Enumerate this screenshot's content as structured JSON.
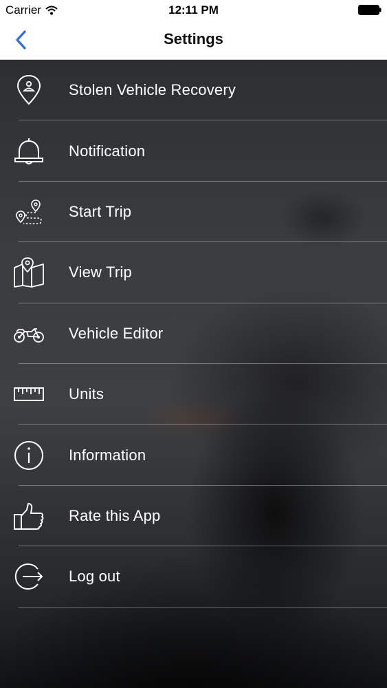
{
  "status_bar": {
    "carrier": "Carrier",
    "time": "12:11 PM"
  },
  "nav": {
    "title": "Settings",
    "accent_color": "#2f6fd6"
  },
  "menu": {
    "items": [
      {
        "label": "Stolen Vehicle Recovery",
        "icon": "location-pin-icon"
      },
      {
        "label": "Notification",
        "icon": "bell-icon"
      },
      {
        "label": "Start Trip",
        "icon": "route-icon"
      },
      {
        "label": "View Trip",
        "icon": "map-icon"
      },
      {
        "label": "Vehicle Editor",
        "icon": "motorcycle-icon"
      },
      {
        "label": "Units",
        "icon": "ruler-icon"
      },
      {
        "label": "Information",
        "icon": "info-icon"
      },
      {
        "label": "Rate this App",
        "icon": "thumbs-up-icon"
      },
      {
        "label": "Log out",
        "icon": "logout-icon"
      }
    ]
  }
}
